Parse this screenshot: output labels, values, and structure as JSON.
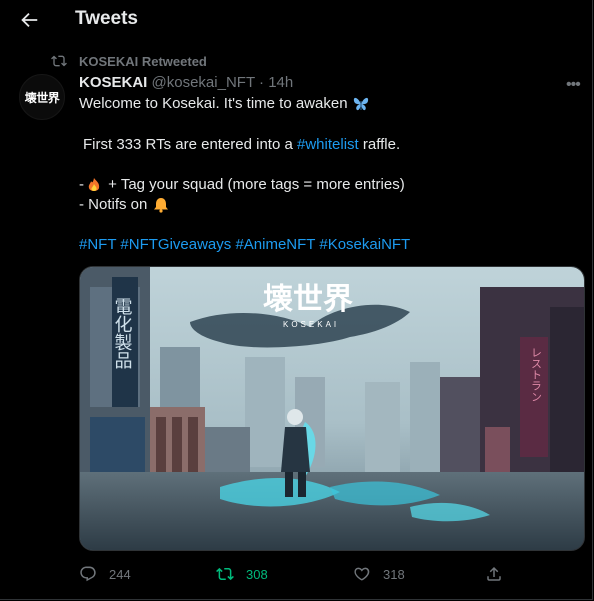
{
  "header": {
    "title": "Tweets",
    "back_icon": "arrow-left-icon"
  },
  "retweet_context": {
    "label": "KOSEKAI Retweeted"
  },
  "tweet": {
    "avatar_text": "壊世界",
    "display_name": "KOSEKAI",
    "handle": "@kosekai_NFT",
    "separator": "·",
    "time": "14h",
    "lines": {
      "l1": "Welcome to Kosekai. It's time to awaken",
      "l2_pre": "First 333 RTs are entered into a ",
      "l2_link": "#whitelist",
      "l2_post": " raffle.",
      "l3_pre": "-",
      "l3_post": " + Tag your squad (more tags = more entries)",
      "l4": "- Notifs on"
    },
    "hashtags": [
      "#NFT",
      "#NFTGiveaways",
      "#AnimeNFT",
      "#KosekaiNFT"
    ],
    "media": {
      "logo_text": "壊世界",
      "logo_sub": "KOSEKAI",
      "sign_left": "電化製品",
      "sign_right": "レストラン"
    },
    "actions": {
      "replies": "244",
      "retweets": "308",
      "likes": "318"
    }
  },
  "colors": {
    "link": "#1d9bf0",
    "retweet_active": "#00ba7c",
    "muted": "#71767b",
    "text": "#e7e9ea",
    "background": "#000000"
  }
}
